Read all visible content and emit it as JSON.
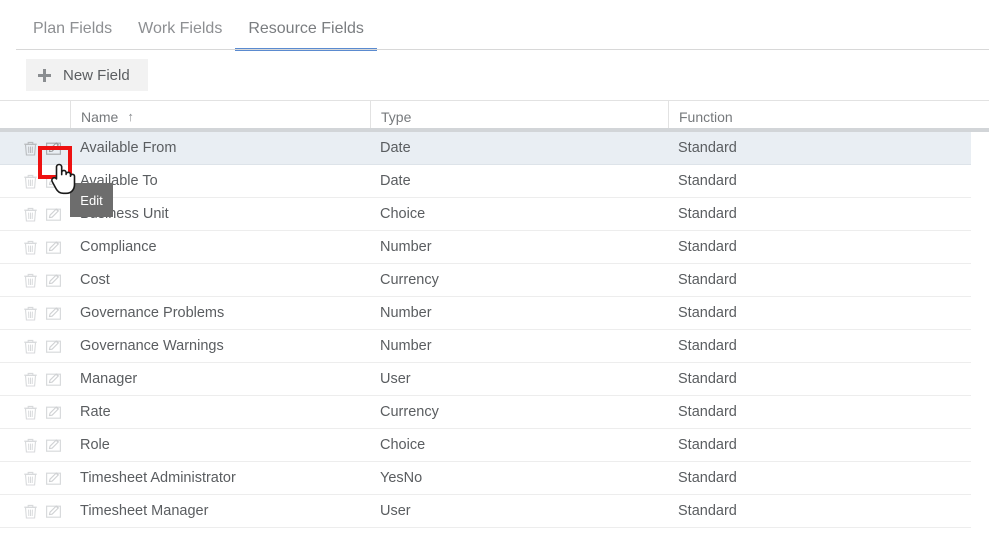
{
  "tabs": [
    {
      "label": "Plan Fields",
      "active": false
    },
    {
      "label": "Work Fields",
      "active": false
    },
    {
      "label": "Resource Fields",
      "active": true
    }
  ],
  "toolbar": {
    "new_field_label": "New Field",
    "plus_icon": "plus-icon"
  },
  "table": {
    "columns": [
      {
        "key": "icons",
        "label": ""
      },
      {
        "key": "name",
        "label": "Name",
        "sort": "↑"
      },
      {
        "key": "type",
        "label": "Type"
      },
      {
        "key": "function",
        "label": "Function"
      }
    ],
    "rows": [
      {
        "name": "Available From",
        "type": "Date",
        "function": "Standard",
        "selected": true
      },
      {
        "name": "Available To",
        "type": "Date",
        "function": "Standard",
        "selected": false
      },
      {
        "name": "Business Unit",
        "type": "Choice",
        "function": "Standard",
        "selected": false
      },
      {
        "name": "Compliance",
        "type": "Number",
        "function": "Standard",
        "selected": false
      },
      {
        "name": "Cost",
        "type": "Currency",
        "function": "Standard",
        "selected": false
      },
      {
        "name": "Governance Problems",
        "type": "Number",
        "function": "Standard",
        "selected": false
      },
      {
        "name": "Governance Warnings",
        "type": "Number",
        "function": "Standard",
        "selected": false
      },
      {
        "name": "Manager",
        "type": "User",
        "function": "Standard",
        "selected": false
      },
      {
        "name": "Rate",
        "type": "Currency",
        "function": "Standard",
        "selected": false
      },
      {
        "name": "Role",
        "type": "Choice",
        "function": "Standard",
        "selected": false
      },
      {
        "name": "Timesheet Administrator",
        "type": "YesNo",
        "function": "Standard",
        "selected": false
      },
      {
        "name": "Timesheet Manager",
        "type": "User",
        "function": "Standard",
        "selected": false
      }
    ],
    "row_icons": {
      "delete": "trash-icon",
      "edit": "edit-pencil-icon"
    }
  },
  "tooltip": {
    "text": "Edit"
  },
  "highlight": {
    "target": "edit-pencil-icon",
    "color": "#ee1111"
  },
  "cursor": {
    "type": "pointer-hand-cursor"
  },
  "colors": {
    "accent": "#5b8bd0",
    "selected_row": "#e9eef3",
    "tooltip_bg": "#6d6d6d",
    "highlight_box": "#ee1111",
    "toolbar_button_bg": "#f2f2f2"
  }
}
